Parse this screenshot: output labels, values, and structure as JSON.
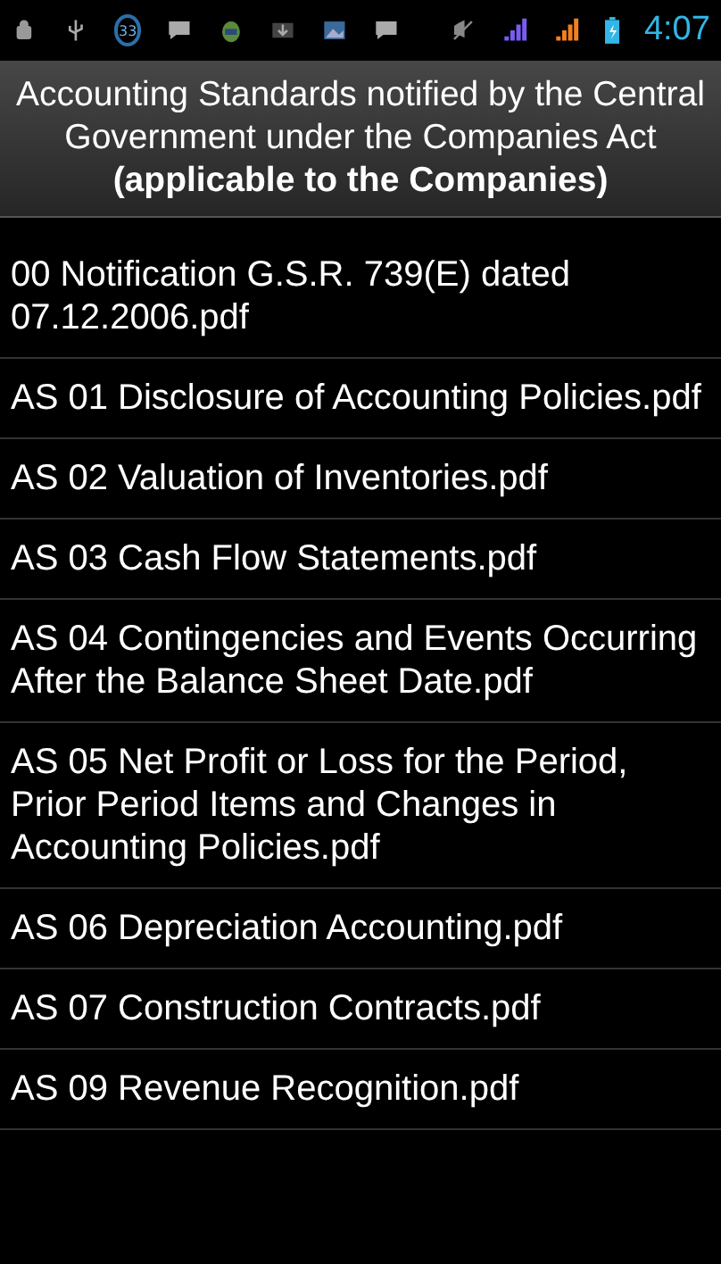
{
  "status_bar": {
    "notification_count": "33",
    "time": "4:07"
  },
  "header": {
    "title": "Accounting Standards notified by the Central Government under the Companies Act **(applicable to the Companies)**"
  },
  "files": [
    {
      "name": "00 Notification G.S.R. 739(E) dated 07.12.2006.pdf"
    },
    {
      "name": "AS 01 Disclosure of Accounting Policies.pdf"
    },
    {
      "name": "AS 02 Valuation of Inventories.pdf"
    },
    {
      "name": "AS 03 Cash Flow Statements.pdf"
    },
    {
      "name": "AS 04 Contingencies and Events Occurring After the Balance Sheet Date.pdf"
    },
    {
      "name": "AS 05 Net Profit or Loss for the Period, Prior Period Items and Changes in Accounting Policies.pdf"
    },
    {
      "name": "AS 06 Depreciation Accounting.pdf"
    },
    {
      "name": "AS 07 Construction Contracts.pdf"
    },
    {
      "name": "AS 09 Revenue Recognition.pdf"
    }
  ]
}
